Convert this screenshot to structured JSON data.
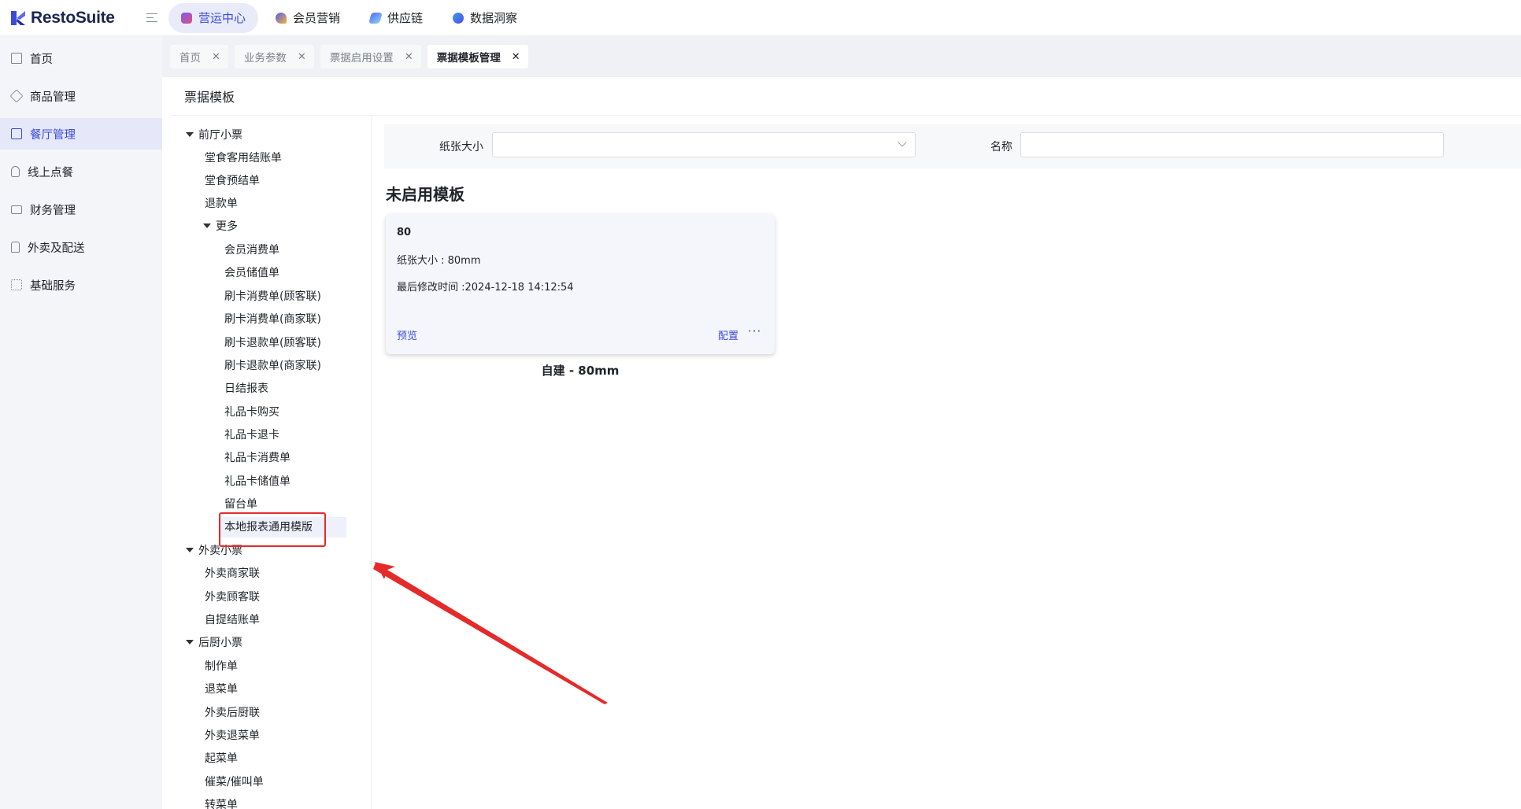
{
  "app": {
    "name": "RestoSuite",
    "brand_color": "#3a4bd8"
  },
  "topnav": [
    {
      "label": "营运中心",
      "icon": "operations-icon",
      "active": true
    },
    {
      "label": "会员营销",
      "icon": "member-marketing-icon"
    },
    {
      "label": "供应链",
      "icon": "supply-chain-icon"
    },
    {
      "label": "数据洞察",
      "icon": "data-insight-icon"
    }
  ],
  "sidebar": {
    "items": [
      {
        "label": "首页",
        "icon": "home-icon"
      },
      {
        "label": "商品管理",
        "icon": "box-icon"
      },
      {
        "label": "餐厅管理",
        "icon": "store-icon",
        "active": true
      },
      {
        "label": "线上点餐",
        "icon": "hand-pointer-icon"
      },
      {
        "label": "财务管理",
        "icon": "wallet-icon"
      },
      {
        "label": "外卖及配送",
        "icon": "bag-icon"
      },
      {
        "label": "基础服务",
        "icon": "grid-icon"
      }
    ]
  },
  "tabs": [
    {
      "label": "首页"
    },
    {
      "label": "业务参数"
    },
    {
      "label": "票据启用设置"
    },
    {
      "label": "票据模板管理",
      "active": true
    }
  ],
  "page": {
    "title": "票据模板"
  },
  "tree": {
    "front": {
      "label": "前厅小票",
      "children": [
        "堂食客用结账单",
        "堂食预结单",
        "退款单"
      ],
      "more": {
        "label": "更多",
        "children": [
          "会员消费单",
          "会员储值单",
          "刷卡消费单(顾客联)",
          "刷卡消费单(商家联)",
          "刷卡退款单(顾客联)",
          "刷卡退款单(商家联)",
          "日结报表",
          "礼品卡购买",
          "礼品卡退卡",
          "礼品卡消费单",
          "礼品卡储值单",
          "留台单",
          "本地报表通用模版"
        ]
      }
    },
    "takeout": {
      "label": "外卖小票",
      "children": [
        "外卖商家联",
        "外卖顾客联",
        "自提结账单"
      ]
    },
    "kitchen": {
      "label": "后厨小票",
      "children": [
        "制作单",
        "退菜单",
        "外卖后厨联",
        "外卖退菜单",
        "起菜单",
        "催菜/催叫单",
        "转菜单"
      ]
    },
    "selected": "本地报表通用模版"
  },
  "filter": {
    "paper_size_label": "纸张大小",
    "paper_size_value": "",
    "name_label": "名称",
    "name_value": ""
  },
  "section": {
    "title": "未启用模板"
  },
  "card": {
    "name": "80",
    "paper_size": "纸张大小 : 80mm",
    "modified": "最后修改时间 :2024-12-18 14:12:54",
    "preview_label": "预览",
    "config_label": "配置",
    "more_label": "···",
    "caption": "自建 - 80mm"
  },
  "annotation": {
    "highlight_color": "#e52a2a"
  }
}
